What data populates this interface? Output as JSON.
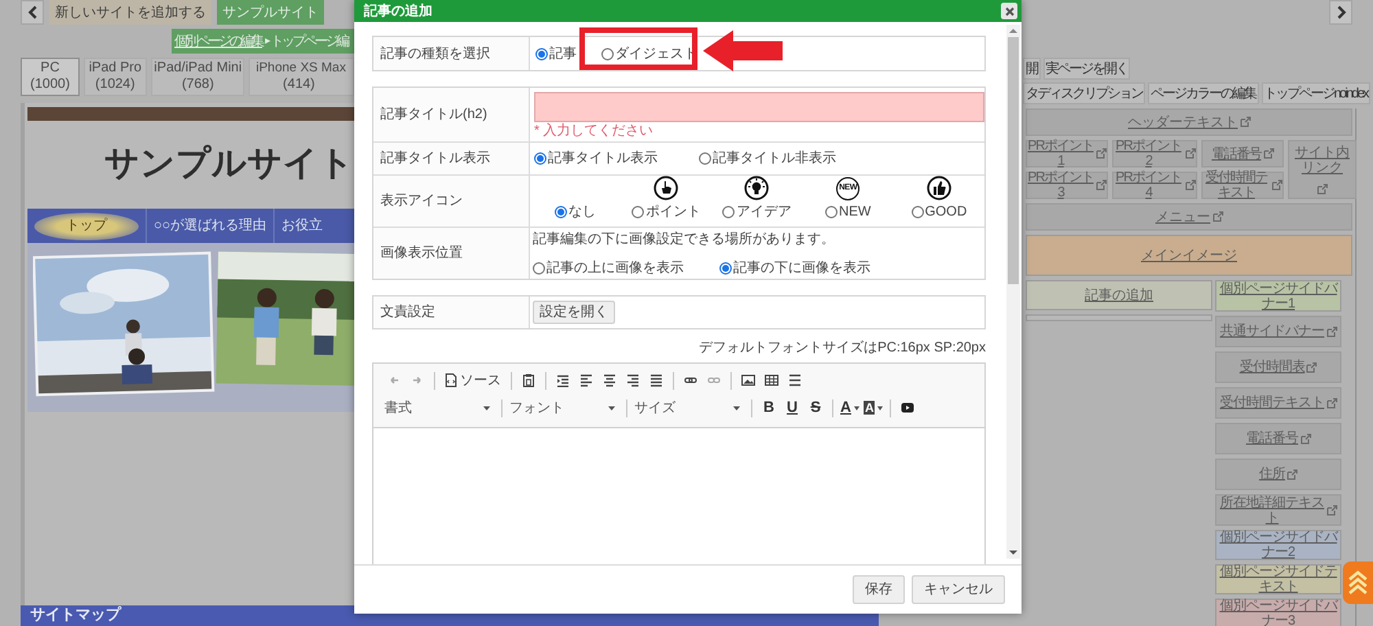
{
  "site_tabs": [
    {
      "label": "新しいサイトを追加する",
      "selected": false
    },
    {
      "label": "サンプルサイト",
      "selected": true
    }
  ],
  "breadcrumb": {
    "link": "個別ページの編集",
    "separator": "▸",
    "current": "トップページ編"
  },
  "device_tabs": [
    {
      "label": "PC",
      "size": "(1000)",
      "selected": true
    },
    {
      "label": "iPad Pro",
      "size": "(1024)",
      "selected": false
    },
    {
      "label": "iPad/iPad Mini",
      "size": "(768)",
      "selected": false
    },
    {
      "label": "iPhone XS Max",
      "size": "(414)",
      "selected": false
    }
  ],
  "preview": {
    "site_title": "サンプルサイト",
    "nav": [
      {
        "label": "トップ",
        "selected": true
      },
      {
        "label": "○○が選ばれる理由",
        "selected": false
      },
      {
        "label": "お役立",
        "selected": false
      }
    ],
    "footer_heading": "サイトマップ"
  },
  "right_panel": {
    "buttons_row1": [
      "開",
      "実ページを開く"
    ],
    "buttons_row2": [
      "タディスクリプション",
      "ページカラーの編集",
      "トップページnoindex"
    ],
    "header": {
      "label": "ヘッダーテキスト",
      "edit": true
    },
    "pr_cells": [
      {
        "label": "PRポイント1",
        "edit": true
      },
      {
        "label": "PRポイント2",
        "edit": true
      },
      {
        "label": "電話番号",
        "edit": true
      },
      {
        "label": "PRポイント3",
        "edit": true
      },
      {
        "label": "PRポイント4",
        "edit": true
      },
      {
        "label": "受付時間テキスト",
        "edit": true
      }
    ],
    "site_link": {
      "label": "サイト内リンク",
      "edit": true
    },
    "menu": {
      "label": "メニュー",
      "edit": true
    },
    "main_image": {
      "label": "メインイメージ",
      "edit": false,
      "color": "#c9ad8e"
    },
    "add_article": {
      "label": "記事の追加",
      "edit": false,
      "color": "#bfc2b3"
    },
    "side": [
      {
        "label": "個別ページサイドバナー1",
        "edit": false,
        "color": "#b7c3a4"
      },
      {
        "label": "共通サイドバナー",
        "edit": true,
        "color": "#a8a8a8"
      },
      {
        "label": "受付時間表",
        "edit": true,
        "color": "#a8a8a8"
      },
      {
        "label": "受付時間テキスト",
        "edit": true,
        "color": "#a8a8a8"
      },
      {
        "label": "電話番号",
        "edit": true,
        "color": "#a8a8a8"
      },
      {
        "label": "住所",
        "edit": true,
        "color": "#a8a8a8"
      },
      {
        "label": "所在地詳細テキスト",
        "edit": true,
        "color": "#a8a8a8"
      },
      {
        "label": "個別ページサイドバナー2",
        "edit": false,
        "color": "#a9b3c3"
      },
      {
        "label": "個別ページサイドテキスト",
        "edit": false,
        "color": "#c3c0a4"
      },
      {
        "label": "個別ページサイドバナー3",
        "edit": false,
        "color": "#c8abab"
      }
    ]
  },
  "modal": {
    "title": "記事の追加",
    "type_row": {
      "label": "記事の種類を選択",
      "options": [
        {
          "label": "記事",
          "selected": true
        },
        {
          "label": "ダイジェスト",
          "selected": false
        }
      ]
    },
    "fields": [
      {
        "kind": "text",
        "label": "記事タイトル(h2)",
        "error": "* 入力してください"
      },
      {
        "kind": "radios",
        "label": "記事タイトル表示",
        "options": [
          {
            "label": "記事タイトル表示",
            "selected": true
          },
          {
            "label": "記事タイトル非表示",
            "selected": false
          }
        ]
      },
      {
        "kind": "icons",
        "label": "表示アイコン",
        "options": [
          {
            "label": "なし",
            "kind": "plain",
            "selected": true
          },
          {
            "label": "ポイント",
            "kind": "pointer",
            "selected": false
          },
          {
            "label": "アイデア",
            "kind": "idea",
            "selected": false
          },
          {
            "label": "NEW",
            "kind": "badge",
            "badge": "NEW",
            "selected": false
          },
          {
            "label": "GOOD",
            "kind": "thumbs",
            "selected": false
          }
        ]
      },
      {
        "kind": "note_radios",
        "label": "画像表示位置",
        "note": "記事編集の下に画像設定できる場所があります。",
        "options": [
          {
            "label": "記事の上に画像を表示",
            "selected": false
          },
          {
            "label": "記事の下に画像を表示",
            "selected": true
          }
        ]
      }
    ],
    "style_row": {
      "label": "文責設定",
      "button": "設定を開く"
    },
    "font_note": "デフォルトフォントサイズはPC:16px SP:20px",
    "editor": {
      "source": "ソース",
      "dropdowns": [
        "書式",
        "フォント",
        "サイズ"
      ],
      "format_buttons": [
        "B",
        "U",
        "S"
      ],
      "color_buttons": [
        "A",
        "A"
      ]
    },
    "buttons": [
      "保存",
      "キャンセル"
    ]
  }
}
